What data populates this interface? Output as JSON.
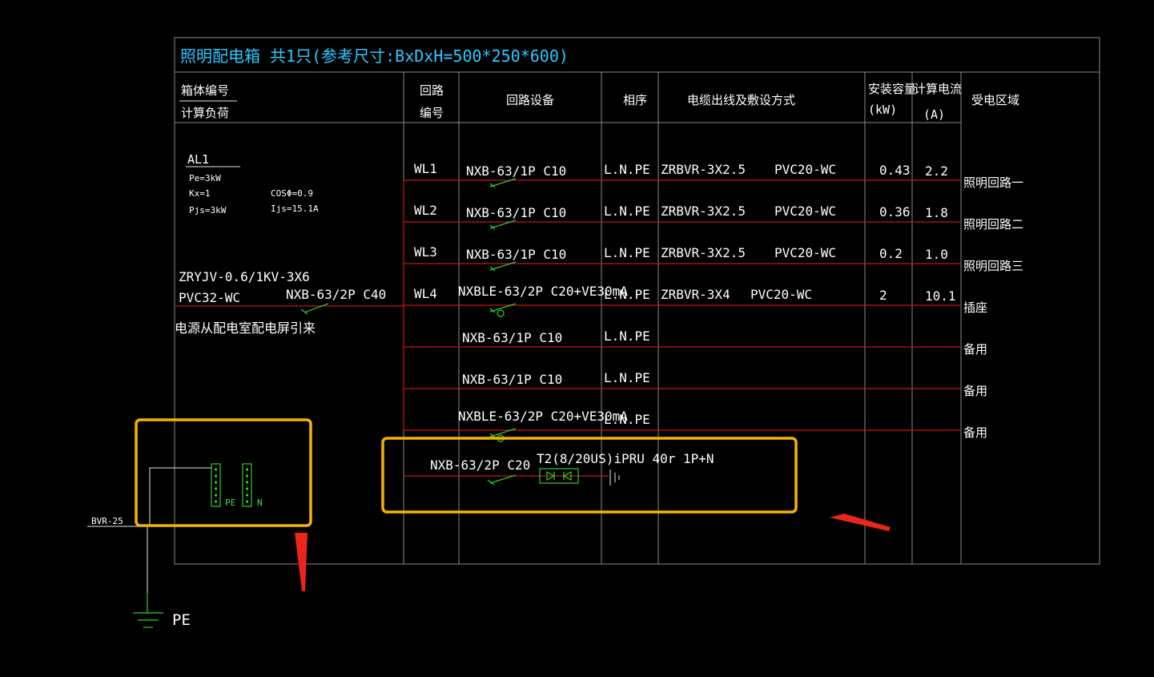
{
  "title": "照明配电箱  共1只(参考尺寸:BxDxH=500*250*600)",
  "headers": {
    "box_no": "箱体编号",
    "calc_load": "计算负荷",
    "circuit_no_1": "回路",
    "circuit_no_2": "编号",
    "device": "回路设备",
    "phase": "相序",
    "cable": "电缆出线及敷设方式",
    "capacity_1": "安装容量",
    "capacity_2": "(kW)",
    "current_1": "计算电流",
    "current_2": "(A)",
    "area": "受电区域"
  },
  "box": {
    "id": "AL1",
    "pe": "Pe=3kW",
    "kx": "Kx=1",
    "cos": "COSΦ=0.9",
    "pjs": "Pjs=3kW",
    "ijs": "Ijs=15.1A"
  },
  "incoming": {
    "cable": "ZRYJV-0.6/1KV-3X6",
    "conduit": "PVC32-WC",
    "breaker": "NXB-63/2P C40",
    "source": "电源从配电室配电屏引来"
  },
  "circuits": [
    {
      "no": "WL1",
      "device": "NXB-63/1P C10",
      "phase": "L.N.PE",
      "cable": "ZRBVR-3X2.5",
      "laying": "PVC20-WC",
      "kw": "0.43",
      "amp": "2.2",
      "area": "照明回路一",
      "type": "mcb"
    },
    {
      "no": "WL2",
      "device": "NXB-63/1P C10",
      "phase": "L.N.PE",
      "cable": "ZRBVR-3X2.5",
      "laying": "PVC20-WC",
      "kw": "0.36",
      "amp": "1.8",
      "area": "照明回路二",
      "type": "mcb"
    },
    {
      "no": "WL3",
      "device": "NXB-63/1P C10",
      "phase": "L.N.PE",
      "cable": "ZRBVR-3X2.5",
      "laying": "PVC20-WC",
      "kw": "0.2",
      "amp": "1.0",
      "area": "照明回路三",
      "type": "mcb"
    },
    {
      "no": "WL4",
      "device": "NXBLE-63/2P C20+VE30mA",
      "phase": "L.N.PE",
      "cable": "ZRBVR-3X4",
      "laying": "PVC20-WC",
      "kw": "2",
      "amp": "10.1",
      "area": "插座",
      "type": "rcd"
    },
    {
      "no": "",
      "device": "NXB-63/1P C10",
      "phase": "L.N.PE",
      "cable": "",
      "laying": "",
      "kw": "",
      "amp": "",
      "area": "备用",
      "type": "none"
    },
    {
      "no": "",
      "device": "NXB-63/1P C10",
      "phase": "L.N.PE",
      "cable": "",
      "laying": "",
      "kw": "",
      "amp": "",
      "area": "备用",
      "type": "none"
    },
    {
      "no": "",
      "device": "NXBLE-63/2P C20+VE30mA",
      "phase": "L.N.PE",
      "cable": "",
      "laying": "",
      "kw": "",
      "amp": "",
      "area": "备用",
      "type": "rcd"
    }
  ],
  "spd": {
    "breaker": "NXB-63/2P C20",
    "device": "T2(8/20US)iPRU 40r 1P+N"
  },
  "grounding": {
    "wire": "BVR-25",
    "pe_bar": "PE",
    "n_bar": "N",
    "earth": "PE"
  },
  "colors": {
    "title": "#2ec8ff",
    "circuit_line": "#c81414",
    "symbol": "#2fcf2f",
    "highlight": "#f5b400",
    "arrow": "#e8261c"
  }
}
